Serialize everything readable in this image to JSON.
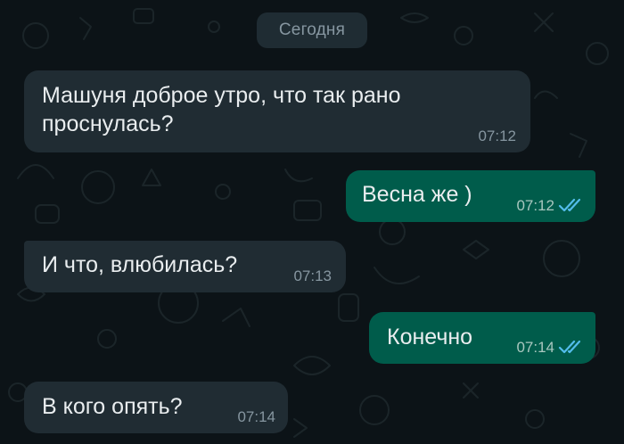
{
  "chat": {
    "date_label": "Сегодня",
    "messages": [
      {
        "direction": "in",
        "text": "Машуня доброе утро, что так рано проснулась?",
        "text_line1": "Машуня доброе утро, что так рано",
        "text_line2": "проснулась?",
        "time": "07:12"
      },
      {
        "direction": "out",
        "text": "Весна же )",
        "time": "07:12",
        "status": "read"
      },
      {
        "direction": "in",
        "text": "И что, влюбилась?",
        "time": "07:13"
      },
      {
        "direction": "out",
        "text": "Конечно",
        "time": "07:14",
        "status": "read"
      },
      {
        "direction": "in",
        "text": "В кого опять?",
        "time": "07:14"
      }
    ]
  },
  "theme": {
    "background": "#0c1317",
    "incoming_bubble": "#202c33",
    "outgoing_bubble": "#005c4b",
    "text": "#e9edef",
    "timestamp": "#8696a0",
    "read_ticks": "#53bdeb"
  },
  "icons": {
    "read_status": "double-check-icon"
  }
}
